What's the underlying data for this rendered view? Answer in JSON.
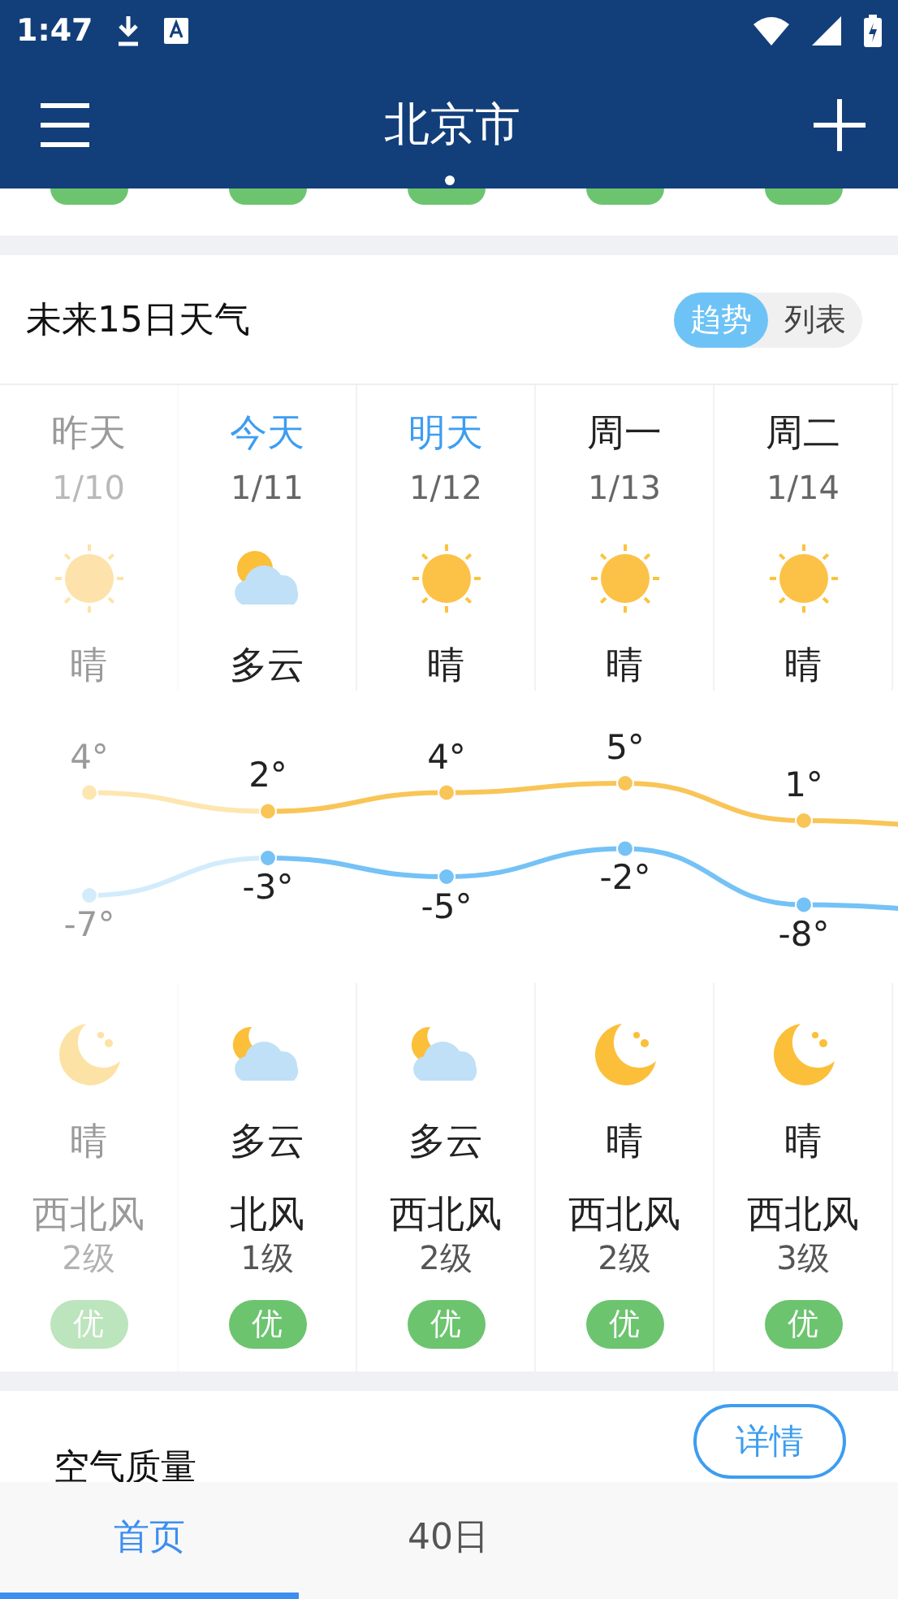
{
  "status_bar": {
    "time": "1:47"
  },
  "app_bar": {
    "title": "北京市"
  },
  "forecast": {
    "title": "未来15日天气",
    "view_toggle": [
      {
        "label": "趋势",
        "selected": true
      },
      {
        "label": "列表",
        "selected": false
      }
    ],
    "days": [
      {
        "day": "昨天",
        "date": "1/10",
        "highlighted": false,
        "past": true,
        "day_icon": {
          "kind": "sun"
        },
        "day_condition": "晴",
        "high": "4°",
        "low": "-7°",
        "night_icon": {
          "kind": "moon"
        },
        "night_condition": "晴",
        "wind": "西北风",
        "wind_level": "2级",
        "aqi": "优"
      },
      {
        "day": "今天",
        "date": "1/11",
        "highlighted": true,
        "past": false,
        "day_icon": {
          "kind": "cloudy"
        },
        "day_condition": "多云",
        "high": "2°",
        "low": "-3°",
        "night_icon": {
          "kind": "cloudy_night"
        },
        "night_condition": "多云",
        "wind": "北风",
        "wind_level": "1级",
        "aqi": "优"
      },
      {
        "day": "明天",
        "date": "1/12",
        "highlighted": true,
        "past": false,
        "day_icon": {
          "kind": "sun"
        },
        "day_condition": "晴",
        "high": "4°",
        "low": "-5°",
        "night_icon": {
          "kind": "cloudy_night"
        },
        "night_condition": "多云",
        "wind": "西北风",
        "wind_level": "2级",
        "aqi": "优"
      },
      {
        "day": "周一",
        "date": "1/13",
        "highlighted": false,
        "past": false,
        "day_icon": {
          "kind": "sun"
        },
        "day_condition": "晴",
        "high": "5°",
        "low": "-2°",
        "night_icon": {
          "kind": "moon"
        },
        "night_condition": "晴",
        "wind": "西北风",
        "wind_level": "2级",
        "aqi": "优"
      },
      {
        "day": "周二",
        "date": "1/14",
        "highlighted": false,
        "past": false,
        "day_icon": {
          "kind": "sun"
        },
        "day_condition": "晴",
        "high": "1°",
        "low": "-8°",
        "night_icon": {
          "kind": "moon"
        },
        "night_condition": "晴",
        "wind": "西北风",
        "wind_level": "3级",
        "aqi": "优"
      }
    ]
  },
  "air_quality": {
    "title": "空气质量",
    "details_button": "详情"
  },
  "tabs": [
    {
      "label": "首页",
      "selected": true
    },
    {
      "label": "40日",
      "selected": false
    }
  ]
}
